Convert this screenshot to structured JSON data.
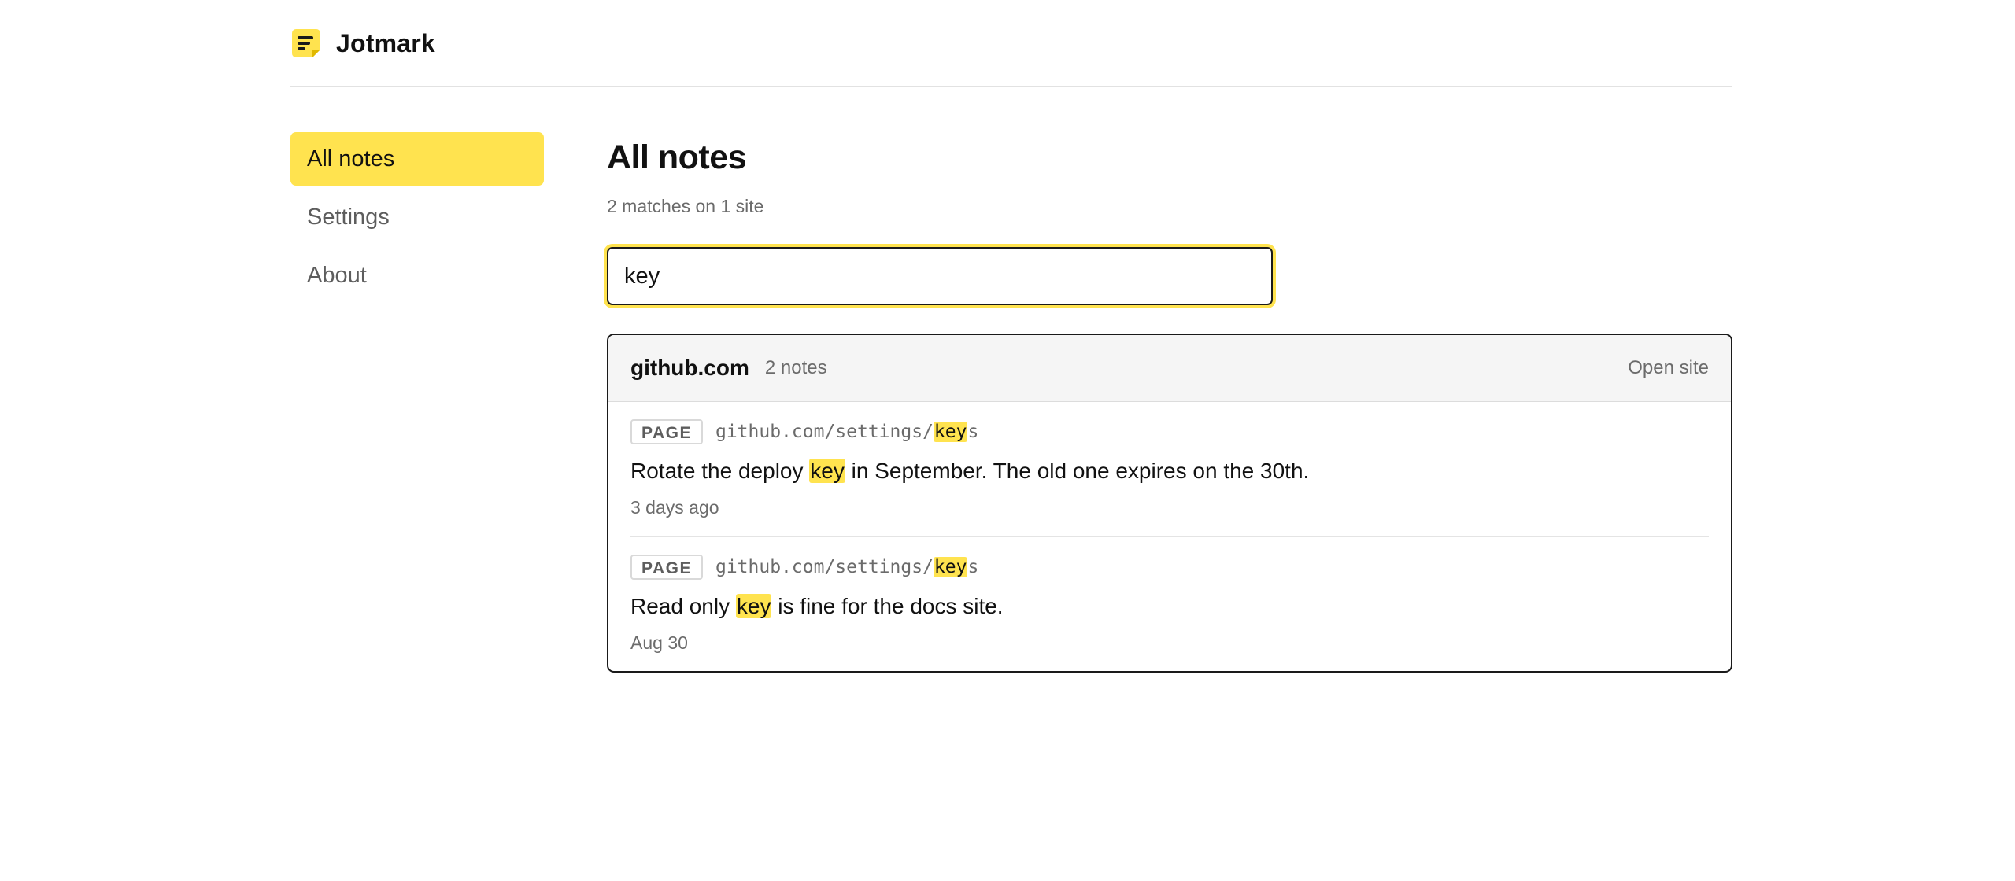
{
  "app": {
    "name": "Jotmark",
    "icon": "notepad-icon",
    "accent_color": "#ffe34f"
  },
  "sidebar": {
    "items": [
      {
        "label": "All notes",
        "active": true
      },
      {
        "label": "Settings",
        "active": false
      },
      {
        "label": "About",
        "active": false
      }
    ]
  },
  "main": {
    "title": "All notes",
    "summary": "2 matches on 1 site",
    "search": {
      "value": "key",
      "placeholder": ""
    },
    "groups": [
      {
        "site": "github.com",
        "count_label": "2 notes",
        "open_label": "Open site",
        "notes": [
          {
            "scope": "PAGE",
            "url_before": "github.com/settings/",
            "url_match": "key",
            "url_after": "s",
            "text_before": "Rotate the deploy ",
            "text_match": "key",
            "text_after": " in September. The old one expires on the 30th.",
            "time": "3 days ago"
          },
          {
            "scope": "PAGE",
            "url_before": "github.com/settings/",
            "url_match": "key",
            "url_after": "s",
            "text_before": "Read only ",
            "text_match": "key",
            "text_after": " is fine for the docs site.",
            "time": "Aug 30"
          }
        ]
      }
    ]
  }
}
